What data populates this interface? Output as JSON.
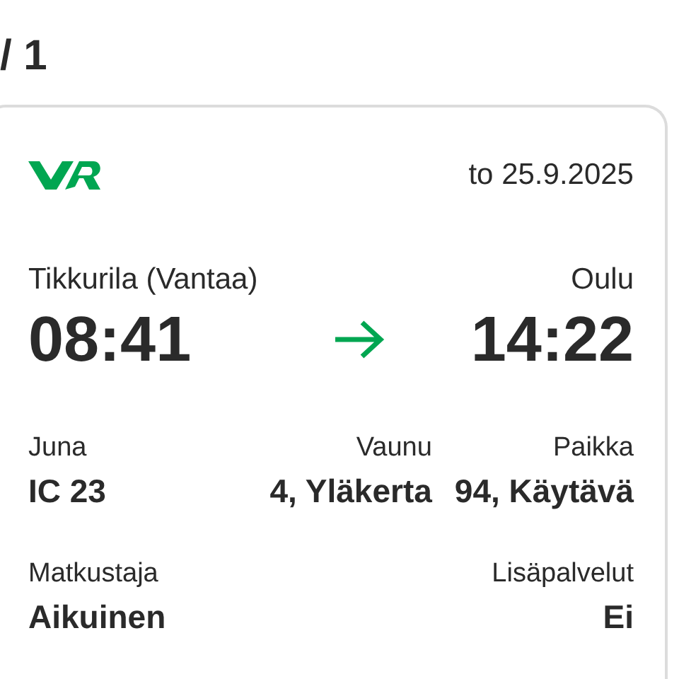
{
  "page_counter": "/ 1",
  "ticket": {
    "date": "to 25.9.2025",
    "origin": {
      "station": "Tikkurila (Vantaa)",
      "time": "08:41"
    },
    "destination": {
      "station": "Oulu",
      "time": "14:22"
    },
    "details": [
      {
        "label": "Juna",
        "value": "IC 23"
      },
      {
        "label": "Vaunu",
        "value": "4, Yläkerta"
      },
      {
        "label": "Paikka",
        "value": "94, Käytävä"
      }
    ],
    "extras": [
      {
        "label": "Matkustaja",
        "value": "Aikuinen"
      },
      {
        "label": "Lisäpalvelut",
        "value": "Ei"
      }
    ]
  }
}
